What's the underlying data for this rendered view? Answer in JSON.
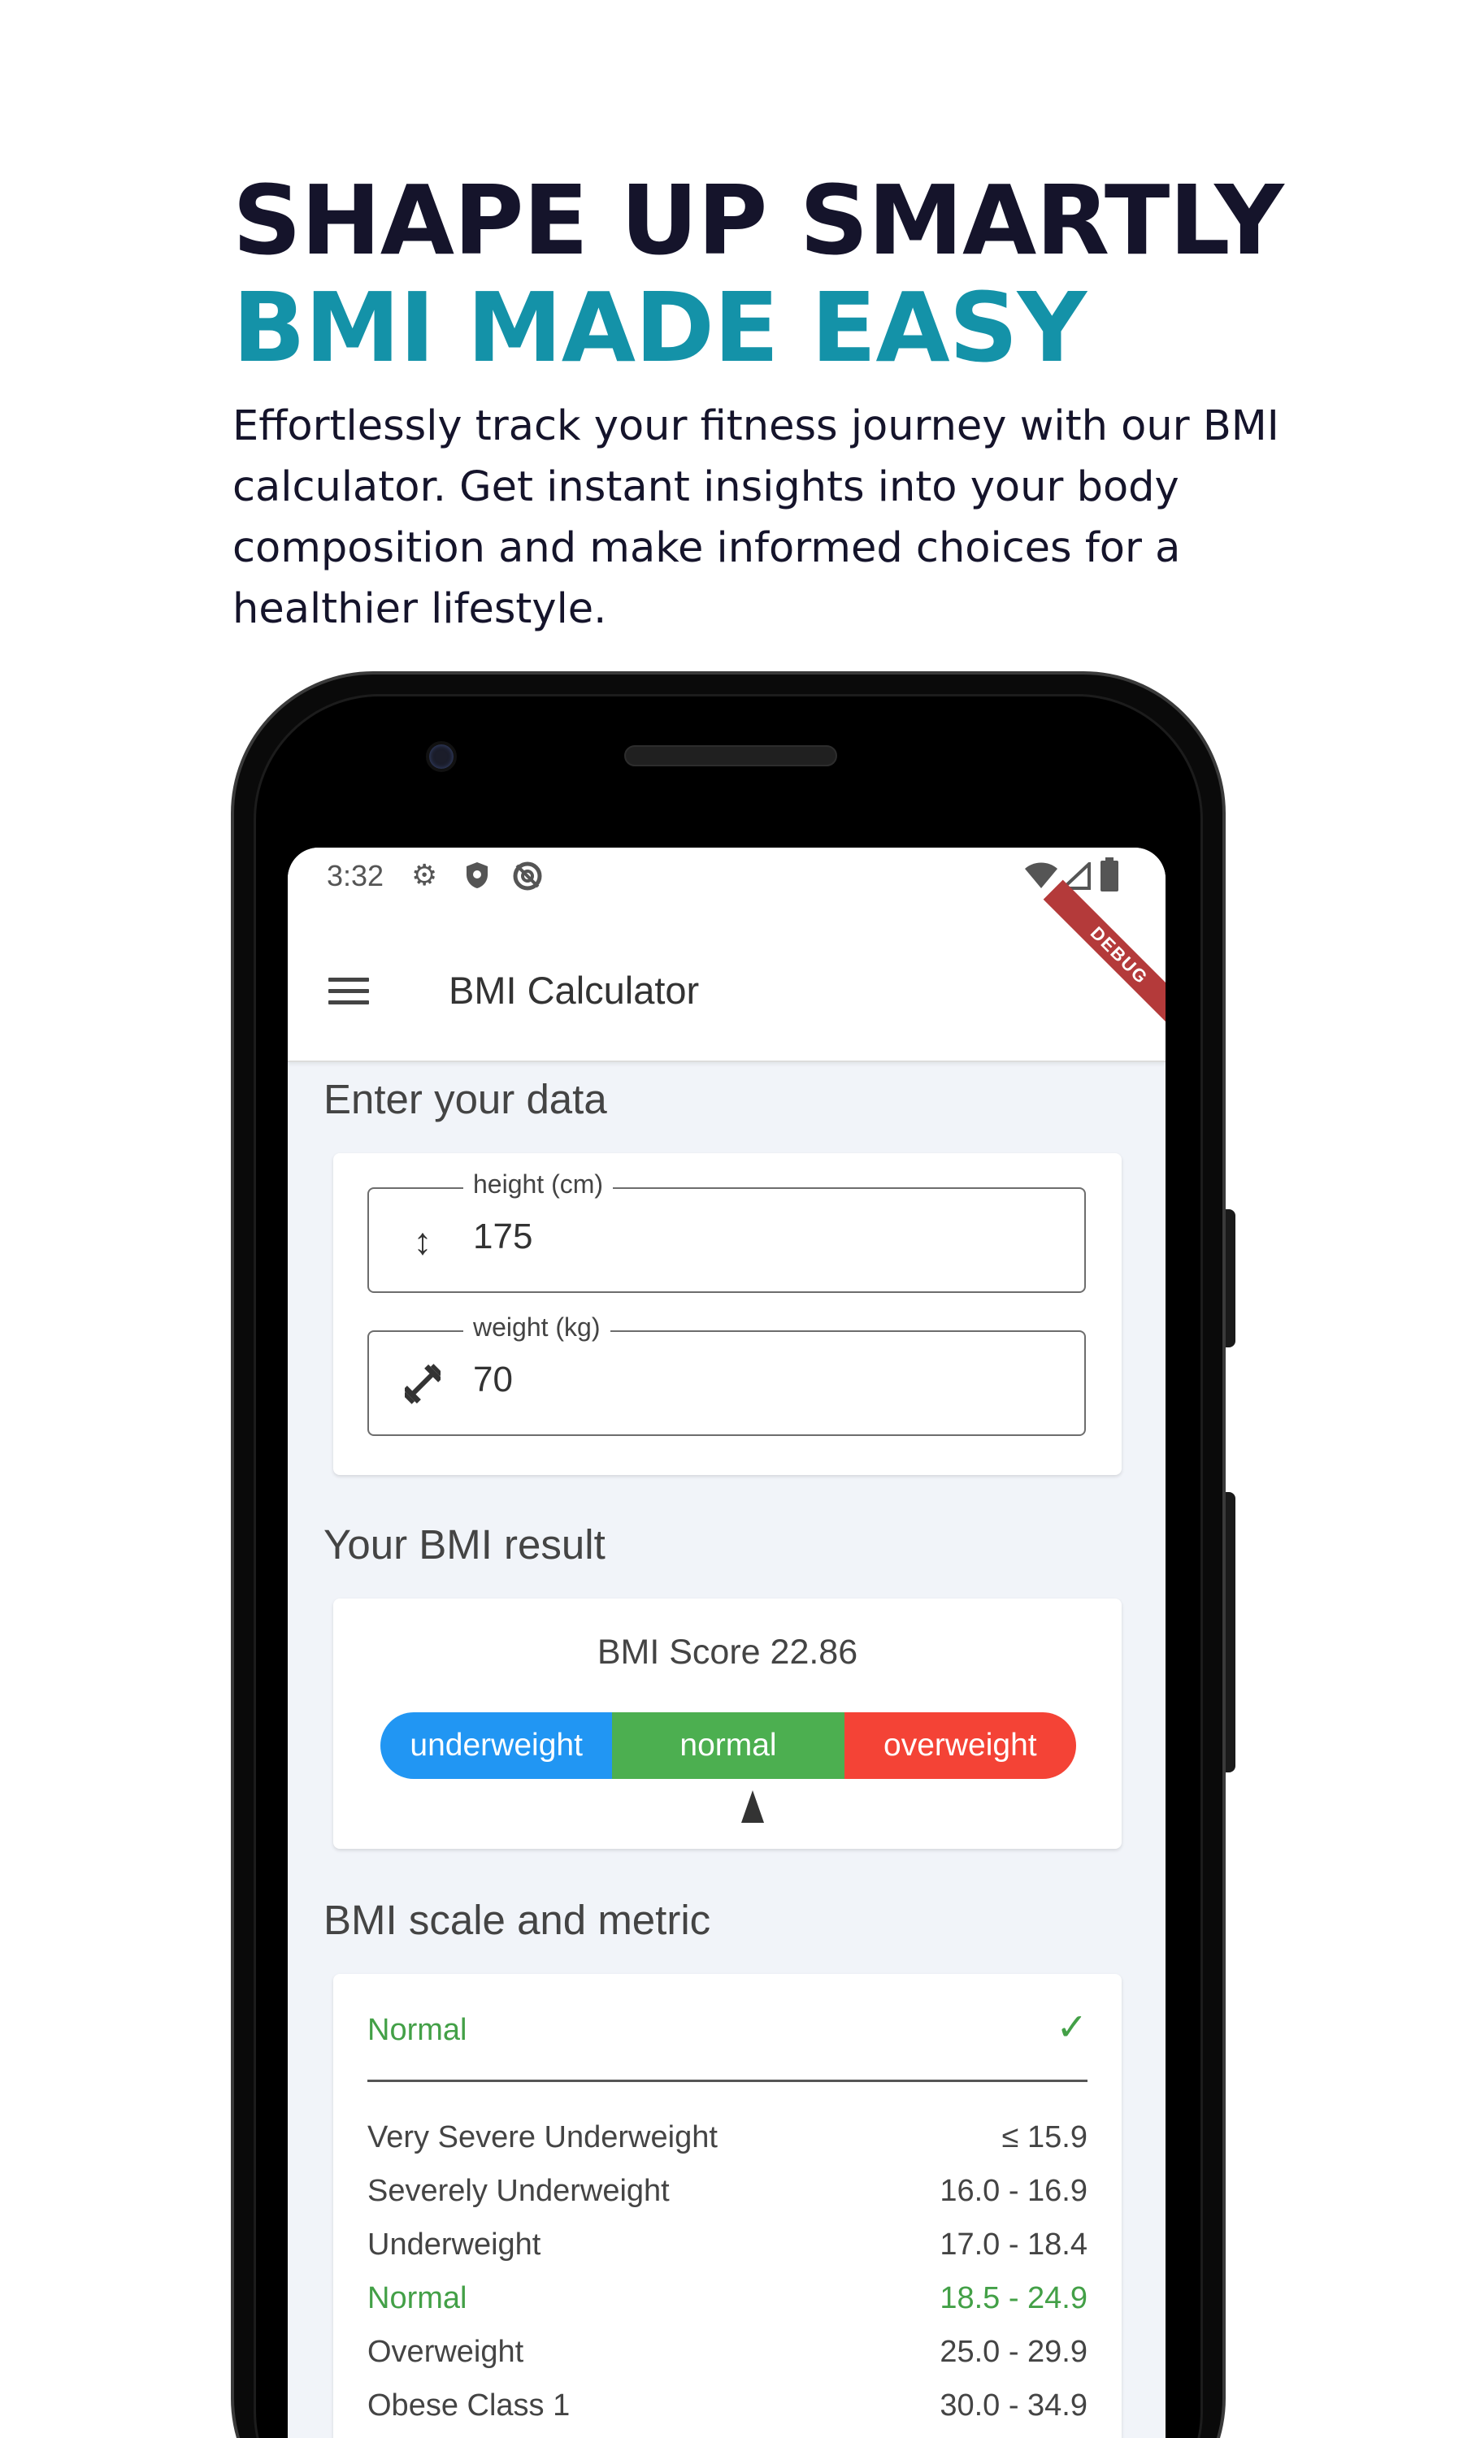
{
  "headline": {
    "line1": "SHAPE UP SMARTLY",
    "line2": "BMI MADE EASY",
    "subtitle": "Effortlessly track your fitness journey with our BMI calculator. Get instant insights into your body composition and make informed choices for a healthier lifestyle."
  },
  "colors": {
    "headline_dark": "#15142b",
    "headline_accent": "#1492a8",
    "underweight": "#2196f3",
    "normal": "#4caf50",
    "overweight": "#f44336",
    "highlight_text": "#43a047"
  },
  "status_bar": {
    "time": "3:32",
    "left_icons": [
      "gear-icon",
      "shield-icon",
      "sync-off-icon"
    ],
    "right_icons": [
      "wifi-icon",
      "signal-icon",
      "battery-icon"
    ]
  },
  "app_bar": {
    "title": "BMI Calculator",
    "menu_icon": "hamburger-menu-icon",
    "debug_banner": "DEBUG"
  },
  "input_section": {
    "title": "Enter your data",
    "height": {
      "label": "height (cm)",
      "value": "175",
      "icon": "height-arrows-icon"
    },
    "weight": {
      "label": "weight (kg)",
      "value": "70",
      "icon": "dumbbell-icon"
    }
  },
  "result_section": {
    "title": "Your BMI result",
    "score_text": "BMI Score 22.86",
    "score": 22.86,
    "segments": [
      "underweight",
      "normal",
      "overweight"
    ],
    "pointer_fraction": 0.535
  },
  "scale_section": {
    "title": "BMI scale and metric",
    "current_category": "Normal",
    "rows": [
      {
        "label": "Very Severe Underweight",
        "range": "≤ 15.9",
        "highlight": false
      },
      {
        "label": "Severely Underweight",
        "range": "16.0 - 16.9",
        "highlight": false
      },
      {
        "label": "Underweight",
        "range": "17.0 - 18.4",
        "highlight": false
      },
      {
        "label": "Normal",
        "range": "18.5 - 24.9",
        "highlight": true
      },
      {
        "label": "Overweight",
        "range": "25.0 - 29.9",
        "highlight": false
      },
      {
        "label": "Obese Class 1",
        "range": "30.0 - 34.9",
        "highlight": false
      }
    ]
  }
}
